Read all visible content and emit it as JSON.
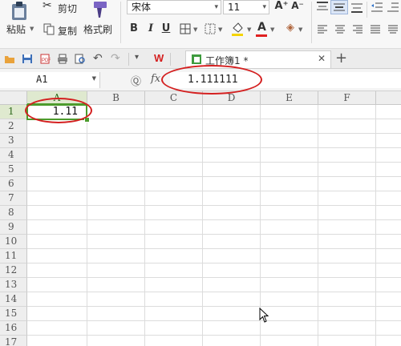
{
  "ribbon": {
    "paste_label": "粘贴",
    "cut_label": "剪切",
    "copy_label": "复制",
    "format_painter_label": "格式刷",
    "font_name": "宋体",
    "font_size": "11",
    "bold": "B",
    "italic": "I",
    "underline": "U",
    "font_color_glyph": "A",
    "grow_font_glyph": "A⁺",
    "shrink_font_glyph": "A⁻"
  },
  "tabs": [
    {
      "label": "工作簿1 *"
    }
  ],
  "formula_bar": {
    "name_box": "A1",
    "fx_label": "fx",
    "value": "1.111111"
  },
  "sheet": {
    "columns": [
      "A",
      "B",
      "C",
      "D",
      "E",
      "F"
    ],
    "rows": [
      "1",
      "2",
      "3",
      "4",
      "5",
      "6",
      "7",
      "8",
      "9",
      "10",
      "11",
      "12",
      "13",
      "14",
      "15",
      "16",
      "17"
    ],
    "active_cell": {
      "ref": "A1",
      "display": "1.11"
    }
  },
  "colors": {
    "selection_green": "#4c9b2c",
    "annotation_red": "#d42020"
  }
}
